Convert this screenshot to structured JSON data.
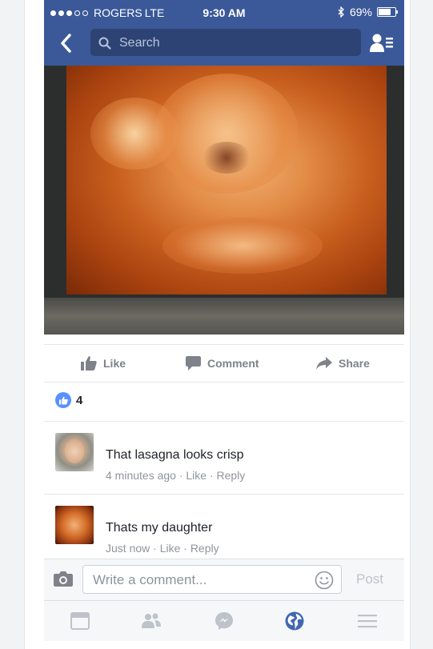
{
  "status_bar": {
    "carrier": "ROGERS",
    "network": "LTE",
    "time": "9:30 AM",
    "battery": "69%",
    "battery_level": 0.69,
    "signal_bars_filled": 3,
    "signal_bars_total": 5
  },
  "nav": {
    "search_placeholder": "Search"
  },
  "actions": {
    "like": "Like",
    "comment": "Comment",
    "share": "Share"
  },
  "likes": {
    "count": "4"
  },
  "comments": [
    {
      "text": "That lasagna looks crisp",
      "meta": "4 minutes ago · Like · Reply"
    },
    {
      "text": "Thats my daughter",
      "meta": "Just now · Like · Reply"
    }
  ],
  "composer": {
    "placeholder": "Write a comment...",
    "post_label": "Post"
  },
  "tabs": [
    "news-feed",
    "friends",
    "messenger",
    "notifications",
    "menu"
  ],
  "colors": {
    "brand": "#3b5998",
    "active_tab": "#4267b2",
    "like_blue": "#5890ff"
  }
}
